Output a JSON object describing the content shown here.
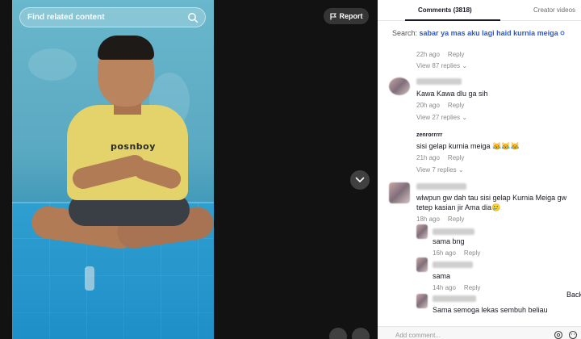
{
  "video": {
    "search_placeholder": "Find related content",
    "report_label": "Report",
    "shirt_print": "posnboy"
  },
  "panel": {
    "tabs": [
      {
        "label": "Comments (3818)",
        "active": true
      },
      {
        "label": "Creator videos",
        "active": false
      }
    ],
    "search_prefix": "Search:",
    "search_keyword": "sabar ya mas aku lagi haid kurnia meiga",
    "add_comment_placeholder": "Add comment...",
    "back_label": "Back",
    "reply_label": "Reply",
    "comments": [
      {
        "username": "",
        "text": "",
        "time": "22h ago",
        "view_replies": "View 87 replies"
      },
      {
        "username": "",
        "text": "Kawa Kawa dlu ga sih",
        "time": "20h ago",
        "view_replies": "View 27 replies"
      },
      {
        "username": "zenrorrrrr",
        "text": "sisi gelap kurnia meiga 😹😹😹",
        "time": "21h ago",
        "view_replies": "View 7 replies"
      },
      {
        "username": "",
        "text": "wlwpun gw dah tau sisi gelap Kurnia Meiga gw tetep kasian jir Ama dia🥲",
        "time": "18h ago",
        "view_replies": ""
      }
    ],
    "replies": [
      {
        "text": "sama bng",
        "time": "16h ago"
      },
      {
        "text": "sama",
        "time": "14h ago"
      },
      {
        "text": "Sama semoga lekas sembuh beliau",
        "time": ""
      }
    ]
  },
  "colors": {
    "accent_link": "#2a5bd7",
    "text_primary": "#161823",
    "text_muted": "#8a8a8a"
  }
}
